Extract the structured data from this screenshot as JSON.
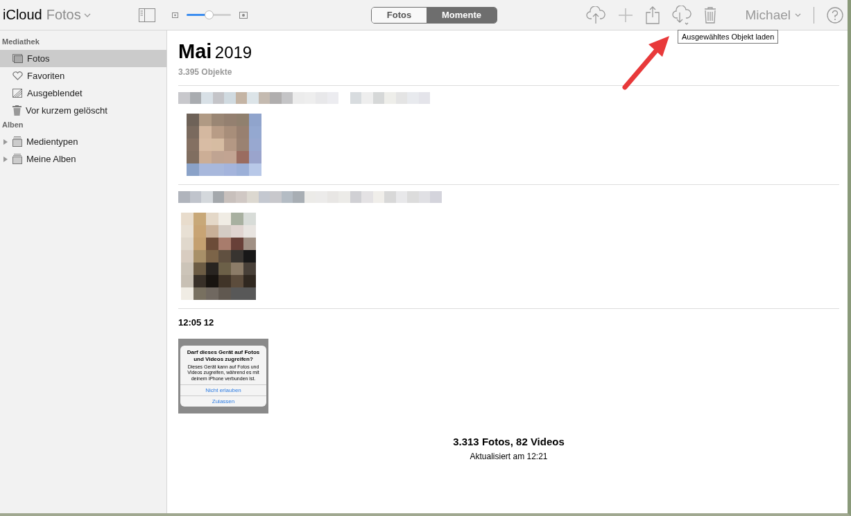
{
  "app": {
    "brand": "iCloud",
    "app_name": "Fotos"
  },
  "toolbar": {
    "zoom_slider": {
      "level": 0.5
    },
    "segments": [
      {
        "label": "Fotos",
        "selected": false
      },
      {
        "label": "Momente",
        "selected": true
      }
    ],
    "user": "Michael",
    "tooltip": "Ausgewähltes Objekt laden"
  },
  "sidebar": {
    "sections": [
      {
        "title": "Mediathek",
        "items": [
          {
            "label": "Fotos",
            "selected": true
          },
          {
            "label": "Favoriten",
            "selected": false
          },
          {
            "label": "Ausgeblendet",
            "selected": false
          },
          {
            "label": "Vor kurzem gelöscht",
            "selected": false
          }
        ]
      },
      {
        "title": "Alben",
        "items": [
          {
            "label": "Medientypen",
            "selected": false,
            "expanded": false
          },
          {
            "label": "Meine Alben",
            "selected": false,
            "expanded": false
          }
        ]
      }
    ]
  },
  "main": {
    "month": "Mai",
    "year": "2019",
    "count": "3.395 Objekte",
    "moments": [
      {
        "kind": "blurred",
        "thumb": {
          "kind": "photo"
        }
      },
      {
        "kind": "blurred",
        "thumb": {
          "kind": "photo"
        }
      },
      {
        "kind": "titled",
        "title": "12:05 12",
        "thumb": {
          "kind": "screenshot",
          "heading": "Darf dieses Gerät auf Fotos und Videos zugreifen?",
          "body": "Dieses Gerät kann auf Fotos und Videos zugreifen, während es mit deinem iPhone verbunden ist.",
          "actions": [
            "Nicht erlauben",
            "Zulassen"
          ]
        }
      }
    ],
    "summary": "3.313 Fotos, 82 Videos",
    "updated": "Aktualisiert am 12:21"
  }
}
